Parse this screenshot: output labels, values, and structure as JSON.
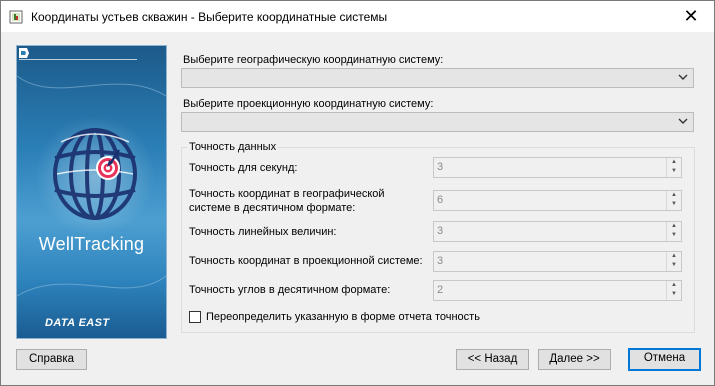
{
  "window": {
    "title": "Координаты устьев скважин - Выберите координатные системы",
    "close_glyph": "✕"
  },
  "banner": {
    "product_name": "WellTracking",
    "company_name": "DATA EAST",
    "colors": {
      "background": "#2b7fb7",
      "accent": "#e8325a"
    }
  },
  "geo_system": {
    "label": "Выберите географическую координатную систему:",
    "value": ""
  },
  "proj_system": {
    "label": "Выберите проекционную координатную систему:",
    "value": ""
  },
  "precision": {
    "group_title": "Точность данных",
    "fields": [
      {
        "label": "Точность для секунд:",
        "value": "3"
      },
      {
        "label_line1": "Точность  координат  в  географической",
        "label_line2": "системе в десятичном формате:",
        "value": "6"
      },
      {
        "label": "Точность линейных величин:",
        "value": "3"
      },
      {
        "label": "Точность координат в проекционной системе:",
        "value": "3"
      },
      {
        "label": "Точность углов в десятичном формате:",
        "value": "2"
      }
    ],
    "override_checkbox": {
      "label": "Переопределить указанную в форме отчета точность",
      "checked": false
    }
  },
  "buttons": {
    "help": "Справка",
    "back": "<< Назад",
    "next": "Далее >>",
    "cancel": "Отмена"
  }
}
